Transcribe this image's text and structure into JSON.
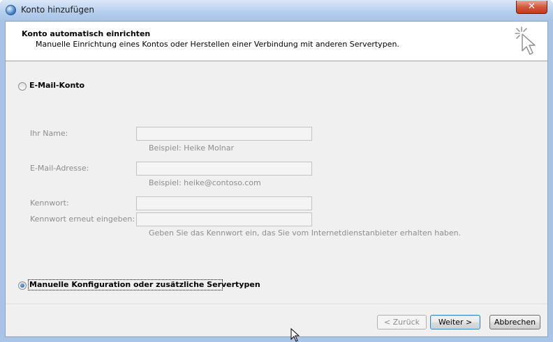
{
  "window": {
    "title": "Konto hinzufügen",
    "close_symbol": "✕"
  },
  "header": {
    "title": "Konto automatisch einrichten",
    "subtitle": "Manuelle Einrichtung eines Kontos oder Herstellen einer Verbindung mit anderen Servertypen.",
    "icon": "wizard-cursor-icon"
  },
  "options": {
    "email_account": {
      "label": "E-Mail-Konto",
      "selected": false
    },
    "manual": {
      "label": "Manuelle Konfiguration oder zusätzliche Servertypen",
      "selected": true
    }
  },
  "form": {
    "name": {
      "label": "Ihr Name:",
      "value": "",
      "hint": "Beispiel: Heike Molnar"
    },
    "email": {
      "label": "E-Mail-Adresse:",
      "value": "",
      "hint": "Beispiel: heike@contoso.com"
    },
    "password": {
      "label": "Kennwort:",
      "value": ""
    },
    "password_repeat": {
      "label": "Kennwort erneut eingeben:",
      "value": ""
    },
    "password_hint": "Geben Sie das Kennwort ein, das Sie vom Internetdienstanbieter erhalten haben."
  },
  "buttons": {
    "back": "< Zurück",
    "next": "Weiter >",
    "cancel": "Abbrechen"
  }
}
